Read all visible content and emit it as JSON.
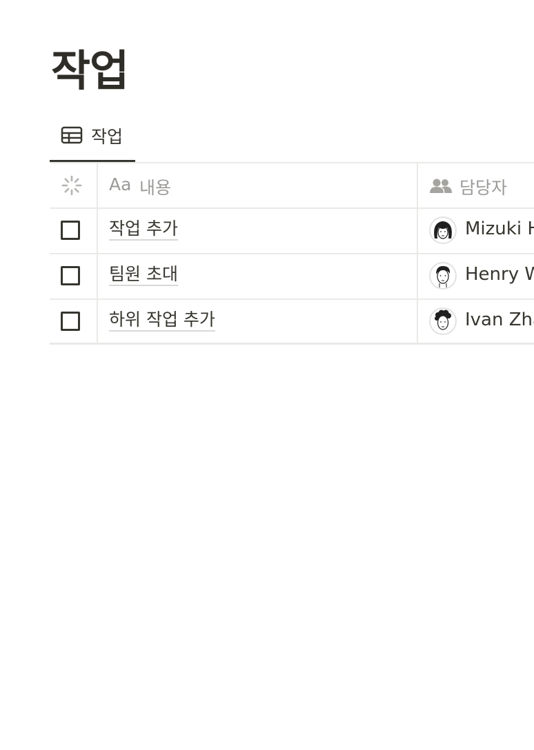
{
  "page": {
    "title": "작업"
  },
  "view": {
    "tab_label": "작업",
    "tab_icon": "table-icon"
  },
  "table": {
    "headers": {
      "status_icon": "loading-spinner-icon",
      "name_prefix": "Aa",
      "name_label": "내용",
      "assignee_icon": "people-icon",
      "assignee_label": "담당자"
    },
    "rows": [
      {
        "checked": false,
        "name": "작업 추가",
        "assignee": "Mizuki H",
        "avatar": "avatar-woman-icon"
      },
      {
        "checked": false,
        "name": "팀원 초대",
        "assignee": "Henry W",
        "avatar": "avatar-man-icon"
      },
      {
        "checked": false,
        "name": "하위 작업 추가",
        "assignee": "Ivan Zha",
        "avatar": "avatar-curly-icon"
      }
    ]
  }
}
